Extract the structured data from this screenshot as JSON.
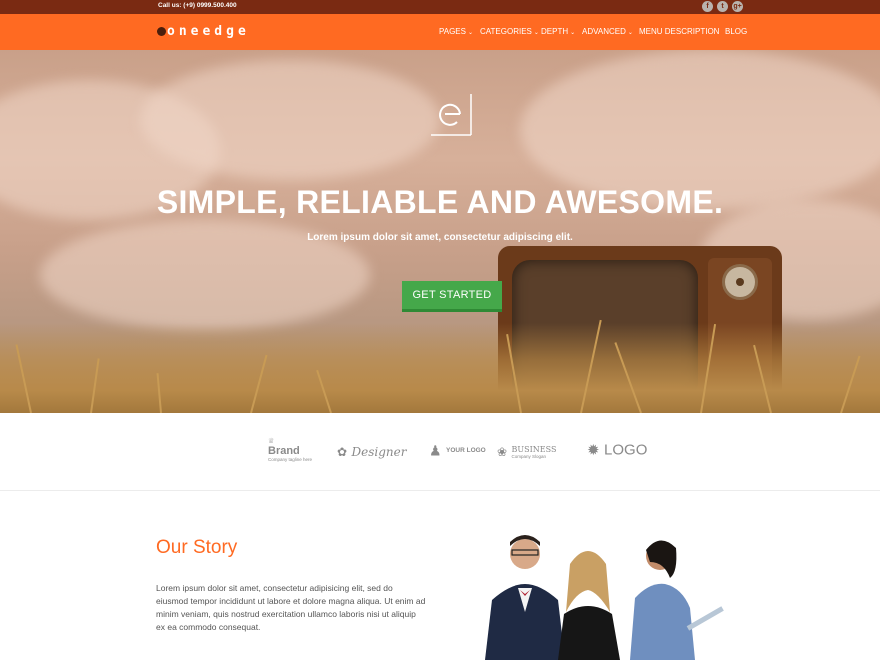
{
  "topbar": {
    "call_text": "Call us: (+9) 0999.500.400",
    "social": [
      {
        "icon": "facebook-icon",
        "glyph": "f"
      },
      {
        "icon": "twitter-icon",
        "glyph": "t"
      },
      {
        "icon": "google-plus-icon",
        "glyph": "g+"
      }
    ]
  },
  "header": {
    "logo_text": "oneedge",
    "nav": [
      {
        "label": "PAGES",
        "dropdown": true
      },
      {
        "label": "CATEGORIES",
        "dropdown": true
      },
      {
        "label": "DEPTH",
        "dropdown": true
      },
      {
        "label": "ADVANCED",
        "dropdown": true
      },
      {
        "label": "MENU DESCRIPTION",
        "dropdown": false
      },
      {
        "label": "BLOG",
        "dropdown": false
      }
    ]
  },
  "hero": {
    "title": "SIMPLE, RELIABLE AND AWESOME.",
    "subtitle": "Lorem ipsum dolor sit amet, consectetur adipiscing elit.",
    "cta_label": "GET STARTED"
  },
  "brands": [
    {
      "name": "Brand",
      "tagline": "Company tagline here"
    },
    {
      "name": "Designer",
      "tagline": ""
    },
    {
      "name": "YOUR LOGO",
      "tagline": ""
    },
    {
      "name": "BUSINESS",
      "tagline": "Company Slogan"
    },
    {
      "name": "LOGO",
      "tagline": ""
    }
  ],
  "story": {
    "title": "Our Story",
    "body": "Lorem ipsum dolor sit amet, consectetur adipisicing elit, sed do eiusmod tempor incididunt ut labore et dolore magna aliqua. Ut enim ad minim veniam, quis nostrud exercitation ullamco laboris nisi ut aliquip ex ea commodo consequat."
  },
  "colors": {
    "accent": "#ff6a22",
    "topbar": "#7a2a12",
    "cta": "#45a84a"
  }
}
